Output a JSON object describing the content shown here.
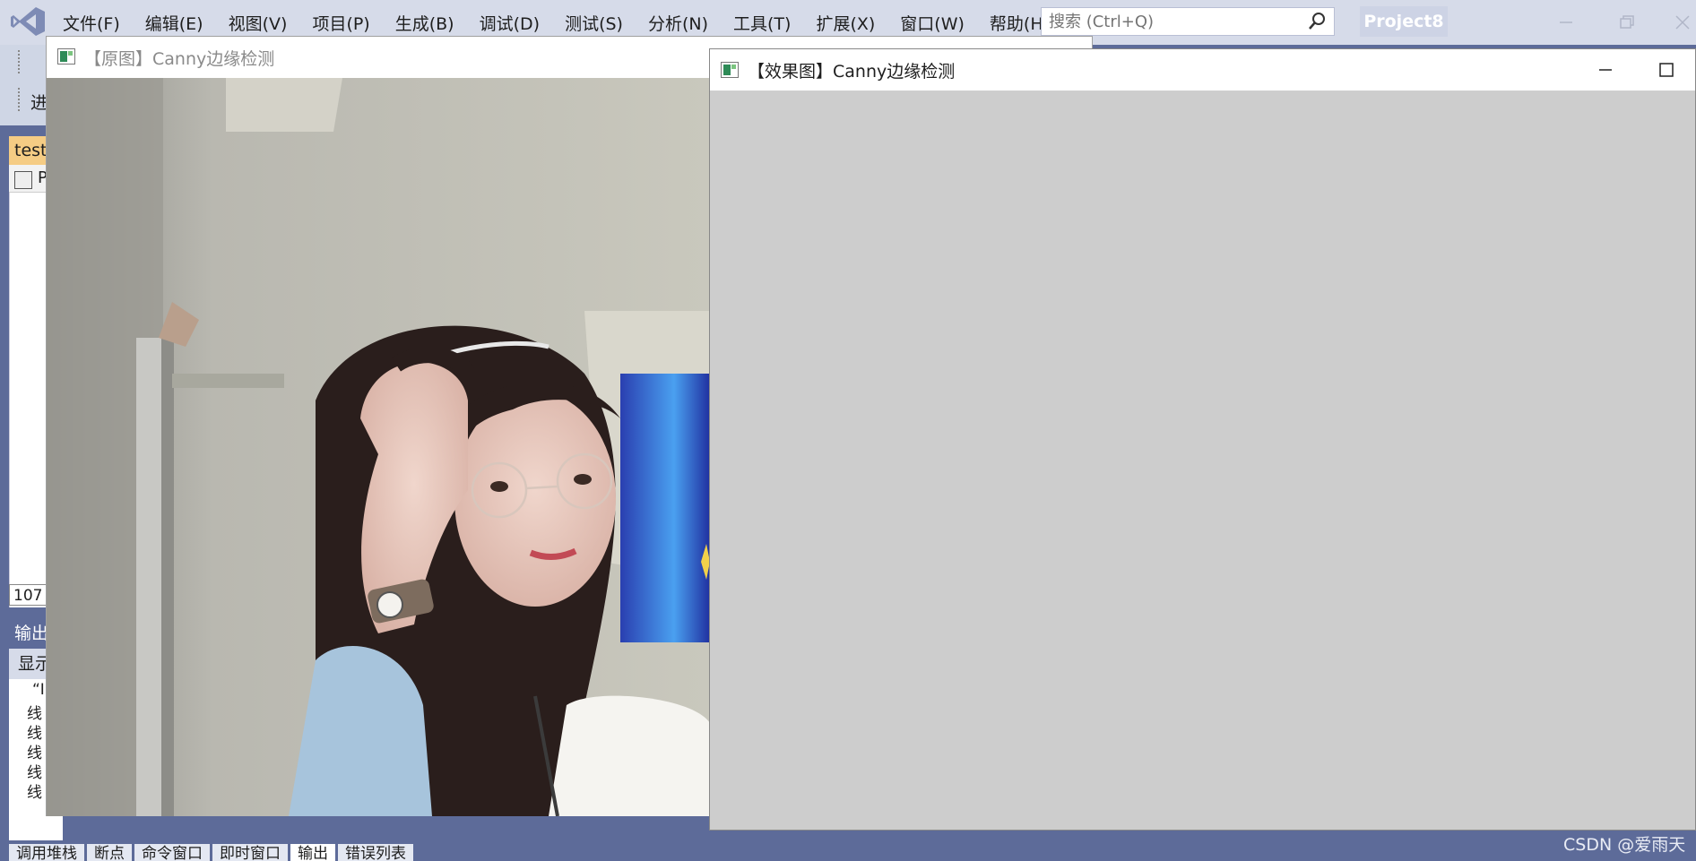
{
  "menu": {
    "items": [
      "文件(F)",
      "编辑(E)",
      "视图(V)",
      "项目(P)",
      "生成(B)",
      "调试(D)",
      "测试(S)",
      "分析(N)",
      "工具(T)",
      "扩展(X)",
      "窗口(W)",
      "帮助(H)"
    ],
    "search_placeholder": "搜索 (Ctrl+Q)",
    "project_name": "Project8"
  },
  "ide": {
    "toolbar_text": "进",
    "doc_tab": "test",
    "editor_nav_text": "P",
    "line_number": "107",
    "output_title": "输出",
    "output_toolbar_text": "显示",
    "output_lines": [
      "“I",
      "线",
      "线",
      "线",
      "线",
      "线"
    ],
    "bottom_tabs": [
      "调用堆栈",
      "断点",
      "命令窗口",
      "即时窗口",
      "输出",
      "错误列表"
    ],
    "active_bottom_tab": "输出"
  },
  "original_window": {
    "title": "【原图】Canny边缘检测"
  },
  "result_window": {
    "title": "【效果图】Canny边缘检测",
    "canvas_color": "#cdcdcd"
  },
  "watermark": "CSDN @爱雨天",
  "colors": {
    "vs_frame": "#5d6b99",
    "menubar": "#d6dbe9",
    "doc_tab": "#f5cc84"
  }
}
